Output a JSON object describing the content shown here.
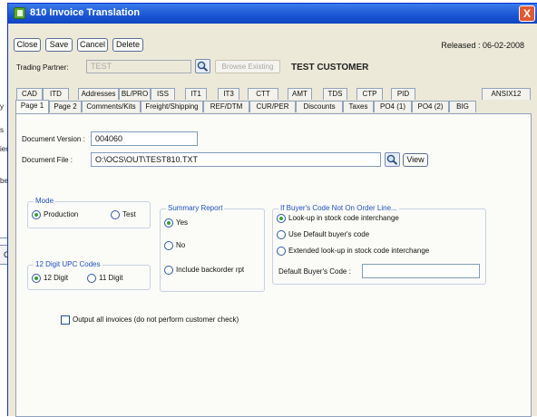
{
  "background": {
    "lines": [
      "y",
      "s",
      "ien",
      "be"
    ]
  },
  "background_cell": "C",
  "window": {
    "title": "810 Invoice Translation",
    "close_glyph": "X"
  },
  "toolbar": {
    "close_label": "Close",
    "save_label": "Save",
    "cancel_label": "Cancel",
    "delete_label": "Delete"
  },
  "released": "Released : 06-02-2008",
  "trading_partner": {
    "label": "Trading Partner:",
    "value": "TEST",
    "browse_label": "Browse Existing",
    "customer_name": "TEST CUSTOMER"
  },
  "tabs_row1": [
    "CAD",
    "ITD",
    "Addresses",
    "BL/PRO",
    "ISS",
    "IT1",
    "IT3",
    "CTT",
    "AMT",
    "TDS",
    "CTP",
    "PID",
    "ANSIX12"
  ],
  "tabs_row2": [
    "Page 1",
    "Page 2",
    "Comments/Kits",
    "Freight/Shipping",
    "REF/DTM",
    "CUR/PER",
    "Discounts",
    "Taxes",
    "PO4 (1)",
    "PO4 (2)",
    "BIG"
  ],
  "document": {
    "version_label": "Document Version :",
    "version_value": "004060",
    "file_label": "Document File :",
    "file_value": "O:\\OCS\\OUT\\TEST810.TXT",
    "view_label": "View"
  },
  "mode": {
    "title": "Mode",
    "production": "Production",
    "test": "Test",
    "selected": "Production"
  },
  "upc": {
    "title": "12 Digit UPC Codes",
    "opt12": "12 Digit",
    "opt11": "11 Digit",
    "selected": "12 Digit"
  },
  "summary": {
    "title": "Summary Report",
    "yes": "Yes",
    "no": "No",
    "include": "Include backorder rpt",
    "selected": "Yes"
  },
  "buyer": {
    "title": "If Buyer's Code Not On Order Line...",
    "opt1": "Look-up in stock code interchange",
    "opt2": "Use Default buyer's code",
    "opt3": "Extended look-up in stock code interchange",
    "selected": "opt1",
    "default_label": "Default Buyer's Code :",
    "default_value": ""
  },
  "output_all": {
    "label": "Output all invoices (do not perform customer check)",
    "checked": false
  }
}
